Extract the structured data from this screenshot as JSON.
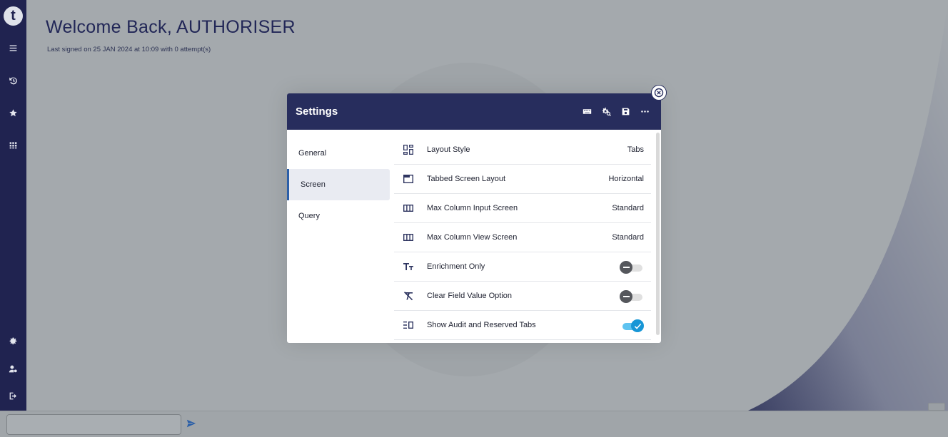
{
  "app": {
    "logo_letter": "t"
  },
  "page": {
    "title": "Welcome Back, AUTHORISER",
    "subtitle": "Last signed on 25 JAN 2024 at 10:09 with 0 attempt(s)"
  },
  "sidebar": {
    "top_icons": [
      "menu-icon",
      "history-icon",
      "star-icon",
      "grid-icon"
    ],
    "bottom_icons": [
      "gear-icon",
      "user-settings-icon",
      "logout-icon"
    ]
  },
  "modal": {
    "title": "Settings",
    "header_icons": [
      "keyboard-icon",
      "settings-search-icon",
      "save-icon",
      "more-icon"
    ],
    "nav": [
      {
        "label": "General"
      },
      {
        "label": "Screen"
      },
      {
        "label": "Query"
      }
    ],
    "active_nav": "Screen",
    "rows": [
      {
        "label": "Layout Style",
        "value": "Tabs",
        "icon": "dashboard-icon"
      },
      {
        "label": "Tabbed Screen Layout",
        "value": "Horizontal",
        "icon": "tab-window-icon"
      },
      {
        "label": "Max Column Input Screen",
        "value": "Standard",
        "icon": "columns-icon"
      },
      {
        "label": "Max Column View Screen",
        "value": "Standard",
        "icon": "columns-icon"
      },
      {
        "label": "Enrichment Only",
        "toggle": false,
        "icon": "text-size-icon"
      },
      {
        "label": "Clear Field Value Option",
        "toggle": false,
        "icon": "clear-format-icon"
      },
      {
        "label": "Show Audit and Reserved Tabs",
        "toggle": true,
        "icon": "list-tabs-icon"
      }
    ]
  },
  "command": {
    "value": ""
  },
  "colors": {
    "sidebar": "#202350",
    "header": "#272d5d",
    "toggle_on": "#1796d6",
    "accent": "#2b5fa8"
  }
}
